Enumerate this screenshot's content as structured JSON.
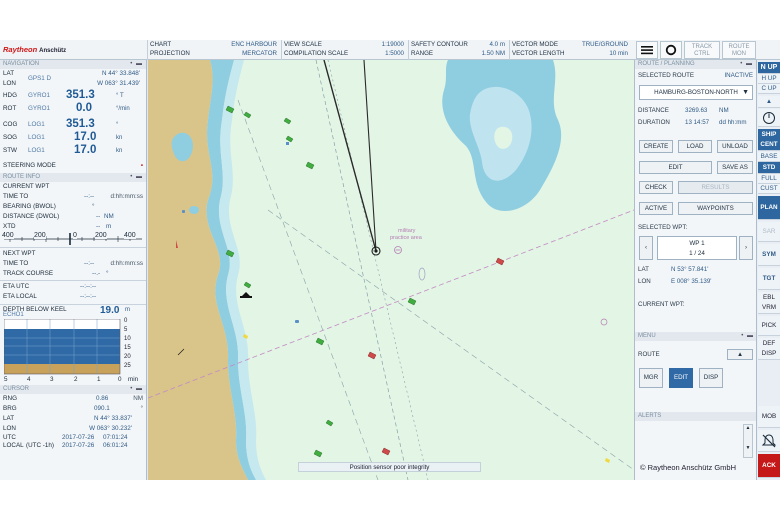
{
  "topbar": {
    "brand_name": "Raytheon",
    "brand_sub": "Anschütz",
    "chart": {
      "k1": "CHART",
      "v1": "ENC HARBOUR",
      "k2": "PROJECTION",
      "v2": "MERCATOR"
    },
    "view": {
      "k1": "VIEW SCALE",
      "v1": "1:19000",
      "k2": "COMPILATION SCALE",
      "v2": "1:5000"
    },
    "safety": {
      "k1": "SAFETY CONTOUR",
      "v1": "4.0 m",
      "k2": "RANGE",
      "v2": "1.50 NM"
    },
    "vector": {
      "k1": "VECTOR MODE",
      "v1": "TRUE/GROUND",
      "k2": "VECTOR LENGTH",
      "v2": "10 min"
    },
    "btn_track": "TRACK CTRL",
    "btn_route": "ROUTE MON"
  },
  "navigation": {
    "header": "NAVIGATION",
    "lat_label": "LAT",
    "lon_label": "LON",
    "pos_sensor": "GPS1 D",
    "lat": "N 44° 33.848'",
    "lon": "W 063° 31.439'",
    "hdg_label": "HDG",
    "hdg_sensor": "GYRO1",
    "hdg_value": "351.3",
    "hdg_unit": "° T",
    "rot_label": "ROT",
    "rot_sensor": "GYRO1",
    "rot_value": "0.0",
    "rot_unit": "°/min",
    "cog_label": "COG",
    "cog_sensor": "LOG1",
    "cog_value": "351.3",
    "cog_unit": "°",
    "sog_label": "SOG",
    "sog_sensor": "LOG1",
    "sog_value": "17.0",
    "sog_unit": "kn",
    "stw_label": "STW",
    "stw_sensor": "LOG1",
    "stw_value": "17.0",
    "stw_unit": "kn",
    "steering_mode": "STEERING MODE"
  },
  "route_info": {
    "header": "ROUTE INFO",
    "current_wpt": "CURRENT WPT",
    "time_to": "TIME TO",
    "time_to_value": "--:--",
    "time_to_unit": "d:hh:mm:ss",
    "bearing": "BEARING (BWOL)",
    "bearing_value": "°",
    "distance": "DISTANCE (DWOL)",
    "distance_value": "--",
    "distance_unit": "NM",
    "xtd": "XTD",
    "xtd_value": "--",
    "xtd_unit": "m",
    "scale_ticks": [
      "400",
      "200",
      "0",
      "200",
      "400"
    ],
    "next_wpt": "NEXT WPT",
    "time_to2": "TIME TO",
    "time_to2_value": "--:--",
    "time_to2_unit": "d:hh:mm:ss",
    "track_course": "TRACK COURSE",
    "track_course_value": "--.-",
    "track_course_unit": "°",
    "eta_utc": "ETA UTC",
    "eta_utc_value": "--:--:--",
    "eta_local": "ETA LOCAL",
    "eta_local_value": "--:--:--"
  },
  "depth": {
    "label": "DEPTH BELOW KEEL",
    "sensor": "ECHO1",
    "value": "19.0",
    "unit": "m",
    "y_ticks": [
      "0",
      "5",
      "10",
      "15",
      "20",
      "25"
    ],
    "x_ticks": [
      "5",
      "4",
      "3",
      "2",
      "1",
      "0"
    ],
    "x_unit": "min"
  },
  "cursor": {
    "header": "CURSOR",
    "rng_label": "RNG",
    "rng_value": "0.86",
    "rng_unit": "NM",
    "brg_label": "BRG",
    "brg_value": "090.1",
    "brg_unit": "°",
    "lat_label": "LAT",
    "lat_value": "N 44° 33.837'",
    "lon_label": "LON",
    "lon_value": "W 063° 30.232'",
    "utc_label": "UTC",
    "utc_date": "2017-07-26",
    "utc_time": "07:01:24",
    "local_label": "LOCAL",
    "local_offset": "(UTC -1h)",
    "local_date": "2017-07-26",
    "local_time": "06:01:24"
  },
  "chart_view": {
    "practice_label1": "military",
    "practice_label2": "practice area",
    "status_message": "Position sensor poor integrity",
    "colors": {
      "land": "#d9c58a",
      "shallow": "#8fcde0",
      "deep": "#bfe3ef",
      "sea": "#e3f5e5"
    }
  },
  "route_planning": {
    "header": "ROUTE / PLANNING",
    "selected_route_label": "SELECTED ROUTE",
    "status": "INACTIVE",
    "route_name": "HAMBURG-BOSTON-NORTH",
    "distance_label": "DISTANCE",
    "distance_value": "3269.63",
    "distance_unit": "NM",
    "duration_label": "DURATION",
    "duration_value": "13 14:57",
    "duration_unit": "dd hh:mm",
    "btn_create": "CREATE",
    "btn_load": "LOAD",
    "btn_unload": "UNLOAD",
    "btn_edit": "EDIT",
    "btn_save_as": "SAVE AS",
    "btn_check": "CHECK",
    "btn_results": "RESULTS",
    "btn_active": "ACTIVE",
    "btn_waypoints": "WAYPOINTS",
    "selected_wpt_label": "SELECTED WPT:",
    "wp_name": "WP 1",
    "wp_index": "1 / 24",
    "lat_label": "LAT",
    "lat_value": "N 53° 57.841'",
    "lon_label": "LON",
    "lon_value": "E 008° 35.139'",
    "current_wpt_label": "CURRENT WPT:"
  },
  "menu": {
    "header": "MENU",
    "route_label": "ROUTE",
    "btn_mgr": "MGR",
    "btn_edit": "EDIT",
    "btn_disp": "DISP"
  },
  "alerts": {
    "header": "ALERTS",
    "copyright": "© Raytheon Anschütz GmbH"
  },
  "strip": {
    "n_up": "N UP",
    "h_up": "H UP",
    "c_up": "C UP",
    "ship": "SHIP",
    "cent": "CENT",
    "base": "BASE",
    "std": "STD",
    "full": "FULL",
    "cust": "CUST",
    "plan": "PLAN",
    "sar": "SAR",
    "sym": "SYM",
    "tgt": "TGT",
    "ebl": "EBL",
    "vrm": "VRM",
    "pick": "PICK",
    "def": "DEF",
    "disp": "DISP",
    "mob": "MOB",
    "ack": "ACK"
  }
}
